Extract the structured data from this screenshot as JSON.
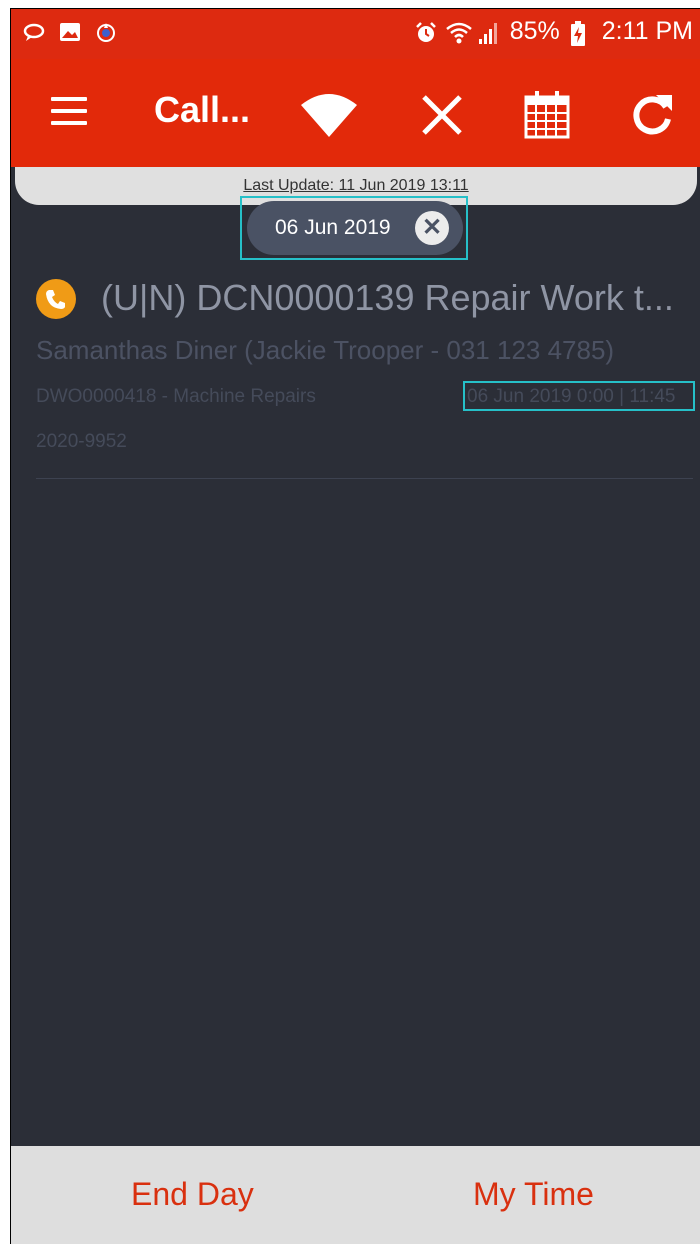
{
  "status_bar": {
    "battery": "85%",
    "time": "2:11 PM",
    "left_icons": [
      "chat-bubble-icon",
      "image-icon",
      "app-notification-icon"
    ],
    "right_icons": [
      "alarm-icon",
      "wifi-icon",
      "signal-icon",
      "battery-charging-icon"
    ]
  },
  "app_bar": {
    "title": "Call...",
    "icons": [
      "menu-icon",
      "wifi-icon",
      "close-icon",
      "calendar-icon",
      "refresh-icon"
    ]
  },
  "banner": {
    "last_update": "Last Update: 11 Jun 2019 13:11"
  },
  "filter_chip": {
    "label": "06 Jun 2019",
    "clear_icon": "clear-icon"
  },
  "calls": [
    {
      "title": "(U|N) DCN0000139 Repair Work t...",
      "customer": "Samanthas Diner (Jackie Trooper - 031 123 4785)",
      "work_order": "DWO0000418 - Machine Repairs",
      "date_time": "06 Jun 2019 0:00 | 11:45",
      "reference": "2020-9952",
      "icon": "phone-icon"
    }
  ],
  "bottom_bar": {
    "end_day": "End Day",
    "my_time": "My Time"
  },
  "colors": {
    "app_bar": "#e2290a",
    "background": "#2b2e37",
    "accent_orange": "#f09b16",
    "highlight_outline": "#26c0c8",
    "bottom_button_text": "#d9300f"
  }
}
